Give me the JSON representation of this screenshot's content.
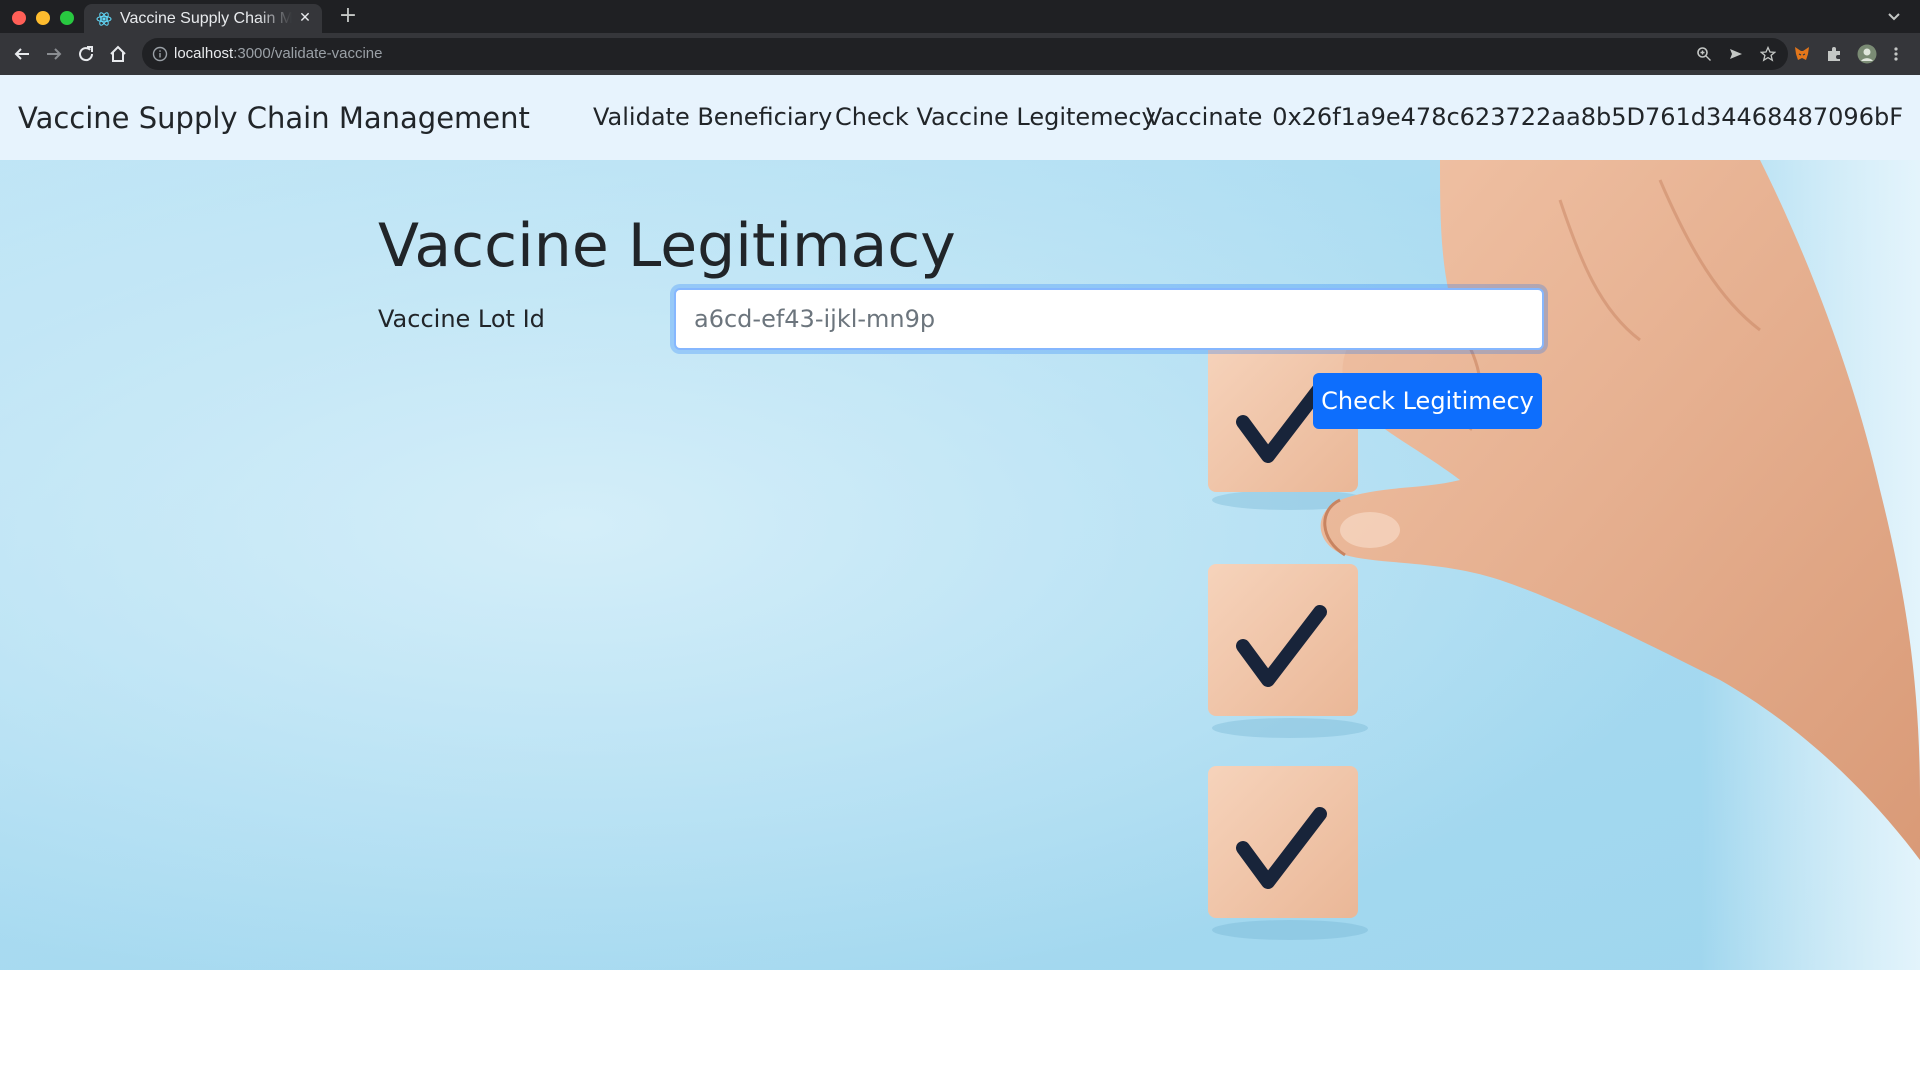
{
  "browser": {
    "tab_title": "Vaccine Supply Chain Management",
    "close_glyph": "✕",
    "new_tab_glyph": "+",
    "url_host": "localhost",
    "url_path": ":3000/validate-vaccine"
  },
  "navbar": {
    "brand": "Vaccine Supply Chain Management",
    "links": [
      "Validate Beneficiary",
      "Check Vaccine Legitemecy",
      "Vaccinate"
    ],
    "account": "0x26f1a9e478c623722aa8b5D761d34468487096bF"
  },
  "main": {
    "heading": "Vaccine Legitimacy",
    "lot_label": "Vaccine Lot Id",
    "lot_placeholder": "a6cd-ef43-ijkl-mn9p",
    "lot_value": "",
    "submit_label": "Check Legitimecy"
  },
  "colors": {
    "primary": "#0d6efd",
    "navbar_bg": "#e7f3fd",
    "hero_bg": "#a9dbf1"
  }
}
